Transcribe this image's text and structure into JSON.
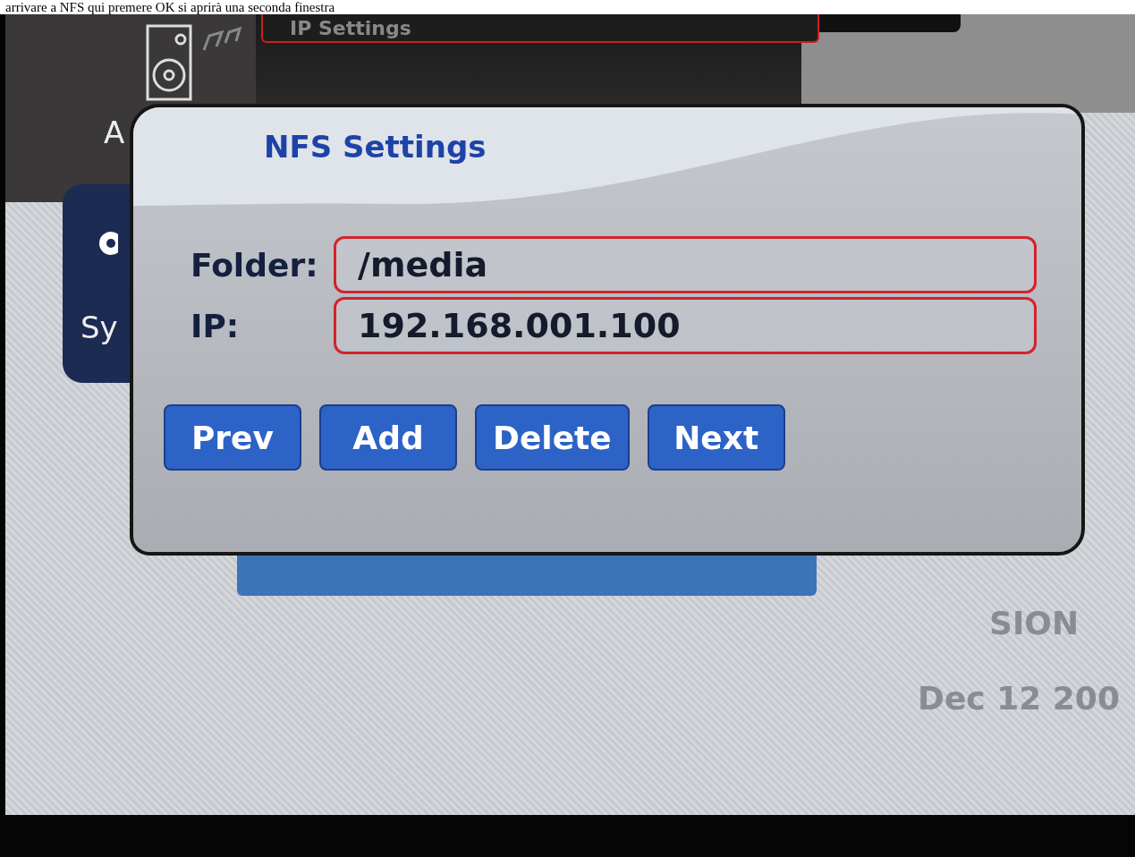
{
  "caption": "arrivare a NFS qui premere OK si aprirà una seconda finestra",
  "background": {
    "menu_items": [
      {
        "label": "A",
        "kind": "speaker"
      },
      {
        "label": "Sy",
        "kind": "gear"
      }
    ],
    "top_field": "IP Settings",
    "faint_text": "SION",
    "date": "Dec 12 200"
  },
  "dialog": {
    "title": "NFS Settings",
    "fields": [
      {
        "label": "Folder:",
        "value": "/media"
      },
      {
        "label": "IP:",
        "value": "192.168.001.100"
      }
    ],
    "buttons": [
      "Prev",
      "Add",
      "Delete",
      "Next"
    ]
  }
}
